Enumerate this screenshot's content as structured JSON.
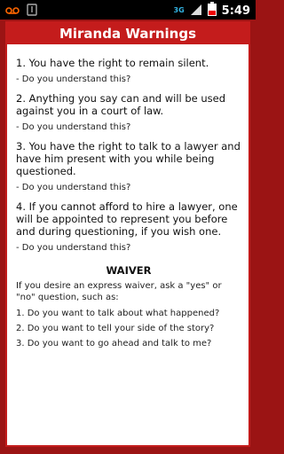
{
  "statusbar": {
    "network": "3G",
    "time": "5:49"
  },
  "header": {
    "title": "Miranda Warnings"
  },
  "rights": [
    {
      "text": "1. You have the right to remain silent.",
      "question": "- Do you understand this?"
    },
    {
      "text": "2. Anything you say can and will be used against you in a court of law.",
      "question": "- Do you understand this?"
    },
    {
      "text": "3. You have the right to talk to a lawyer and have him present with you while being questioned.",
      "question": "- Do you understand this?"
    },
    {
      "text": "4. If you cannot afford to hire a lawyer, one will be appointed to represent you before and during questioning, if you wish one.",
      "question": "- Do you understand this?"
    }
  ],
  "waiver": {
    "heading": "WAIVER",
    "intro": "If you desire an express waiver, ask a \"yes\" or \"no\" question, such as:",
    "questions": [
      "1. Do you want to talk about what happened?",
      "2. Do you want to tell your side of the story?",
      "3. Do you want to go ahead and talk to me?"
    ]
  }
}
